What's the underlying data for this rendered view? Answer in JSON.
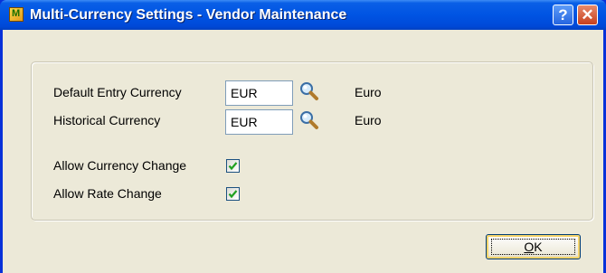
{
  "window": {
    "title": "Multi-Currency Settings - Vendor Maintenance",
    "help_label": "?",
    "close_label": "✕",
    "app_icon": "app-icon"
  },
  "form": {
    "default_entry_currency": {
      "label": "Default Entry Currency",
      "value": "EUR",
      "description": "Euro",
      "lookup_icon": "magnifier-icon"
    },
    "historical_currency": {
      "label": "Historical Currency",
      "value": "EUR",
      "description": "Euro",
      "lookup_icon": "magnifier-icon"
    },
    "allow_currency_change": {
      "label": "Allow Currency Change",
      "checked": true
    },
    "allow_rate_change": {
      "label": "Allow Rate Change",
      "checked": true
    }
  },
  "buttons": {
    "ok_mnemonic": "O",
    "ok_rest": "K"
  },
  "colors": {
    "titlebar": "#0054e3",
    "client_bg": "#ece9d8",
    "close_button": "#c7401e",
    "checkmark": "#21a121"
  }
}
